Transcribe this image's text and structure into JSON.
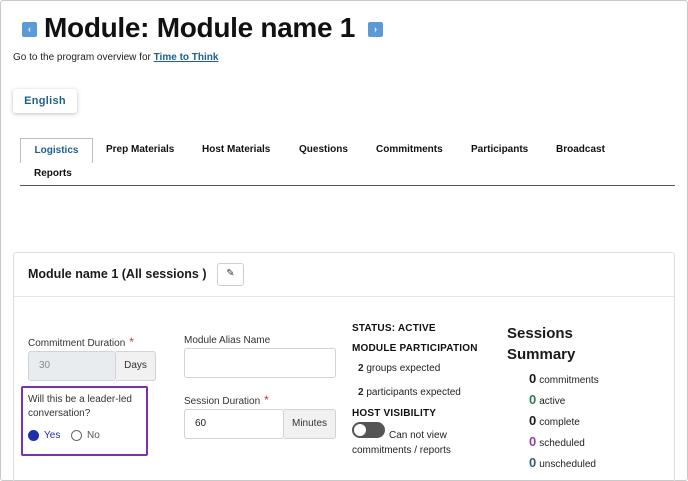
{
  "header": {
    "prev_arrow": "‹",
    "next_arrow": "›",
    "title": "Module: Module name 1",
    "overview_prefix": "Go to the program overview for",
    "overview_link": "Time to Think"
  },
  "language_button": "English",
  "tabs": [
    {
      "label": "Logistics",
      "active": true
    },
    {
      "label": "Prep Materials"
    },
    {
      "label": "Host Materials"
    },
    {
      "label": "Questions"
    },
    {
      "label": "Commitments"
    },
    {
      "label": "Participants"
    },
    {
      "label": "Broadcast"
    },
    {
      "label": "Reports"
    }
  ],
  "card": {
    "title": "Module name 1 (All sessions )",
    "edit_icon": "pencil-icon"
  },
  "form": {
    "commitment_duration_label": "Commitment Duration",
    "commitment_duration_value": "30",
    "commitment_duration_unit": "Days",
    "leader_led_question": "Will this be a leader-led conversation?",
    "yes_label": "Yes",
    "no_label": "No",
    "selected": "Yes",
    "alias_label": "Module Alias Name",
    "alias_value": "",
    "session_duration_label": "Session Duration",
    "session_duration_value": "60",
    "session_duration_unit": "Minutes",
    "required_mark": "*"
  },
  "status": {
    "status_text": "STATUS: ACTIVE",
    "participation_head": "MODULE PARTICIPATION",
    "groups_count": "2",
    "groups_label": "groups expected",
    "participants_count": "2",
    "participants_label": "participants expected",
    "host_visibility_head": "HOST VISIBILITY",
    "host_visibility_text": "Can not view commitments / reports",
    "host_visibility_on": false
  },
  "summary": {
    "title": "Sessions Summary",
    "rows": [
      {
        "count": "0",
        "label": "commitments",
        "color": "#1a1a1a"
      },
      {
        "count": "0",
        "label": "active",
        "color": "#2e7d4f"
      },
      {
        "count": "0",
        "label": "complete",
        "color": "#1a1a1a"
      },
      {
        "count": "0",
        "label": "scheduled",
        "color": "#8e3fb5"
      },
      {
        "count": "0",
        "label": "unscheduled",
        "color": "#2f5d7a"
      }
    ]
  },
  "colors": {
    "accent": "#1f5f8b",
    "highlight_box": "#7b2fb3",
    "required": "#e0303a"
  }
}
